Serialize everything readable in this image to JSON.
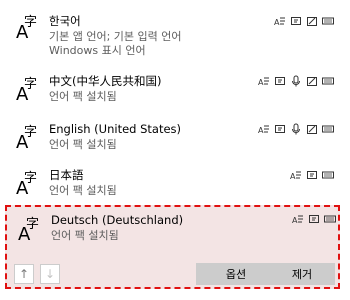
{
  "languages": [
    {
      "name": "한국어",
      "sub1": "기본 앱 언어; 기본 입력 언어",
      "sub2": "Windows 표시 언어",
      "features": [
        "text-to-speech-icon",
        "language-pack-icon",
        "handwriting-icon",
        "keyboard-icon"
      ]
    },
    {
      "name": "中文(中华人民共和国)",
      "sub1": "언어 팩 설치됨",
      "features": [
        "text-to-speech-icon",
        "language-pack-icon",
        "speech-recognition-icon",
        "handwriting-icon",
        "keyboard-icon"
      ]
    },
    {
      "name": "English (United States)",
      "sub1": "언어 팩 설치됨",
      "features": [
        "text-to-speech-icon",
        "language-pack-icon",
        "speech-recognition-icon",
        "handwriting-icon",
        "keyboard-icon"
      ]
    },
    {
      "name": "日本語",
      "sub1": "언어 팩 설치됨",
      "features": [
        "text-to-speech-icon",
        "language-pack-icon",
        "keyboard-icon"
      ]
    },
    {
      "name": "Deutsch (Deutschland)",
      "sub1": "언어 팩 설치됨",
      "features": [
        "text-to-speech-icon",
        "language-pack-icon",
        "keyboard-icon"
      ]
    }
  ],
  "language_icon_glyphs": {
    "a": "A",
    "zi": "字"
  },
  "controls": {
    "move_up_icon": "↑",
    "move_down_icon": "↓",
    "options_label": "옵션",
    "remove_label": "제거"
  },
  "colors": {
    "selected_bg": "#f3e4e4",
    "highlight_border": "#e01010",
    "button_bg": "#cccccc"
  }
}
